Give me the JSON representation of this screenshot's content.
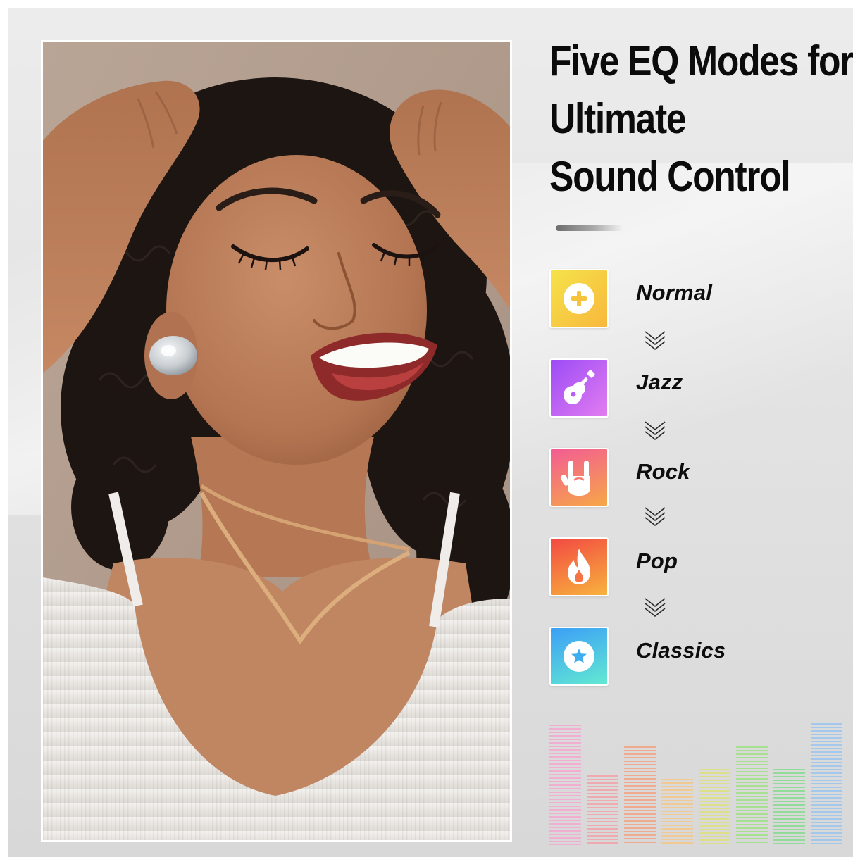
{
  "headline": {
    "line1": "Five EQ Modes for",
    "line2": "Ultimate",
    "line3": "Sound Control"
  },
  "modes": [
    {
      "label": "Normal",
      "icon": "plus-circle-icon",
      "gradient": [
        "#f4d73b",
        "#f9b43c"
      ]
    },
    {
      "label": "Jazz",
      "icon": "guitar-icon",
      "gradient": [
        "#b04ff5",
        "#d46ef3"
      ]
    },
    {
      "label": "Rock",
      "icon": "rock-hand-icon",
      "gradient": [
        "#f46b8c",
        "#f7a24b"
      ]
    },
    {
      "label": "Pop",
      "icon": "flame-icon",
      "gradient": [
        "#f4503f",
        "#f8a43d"
      ]
    },
    {
      "label": "Classics",
      "icon": "star-circle-icon",
      "gradient": [
        "#3ea6f6",
        "#5ee6d8"
      ]
    }
  ],
  "equalizer": {
    "levels": [
      0.95,
      0.55,
      0.78,
      0.52,
      0.6,
      0.78,
      0.6,
      0.96
    ],
    "colors": [
      "#f5a6cf",
      "#f3a1a8",
      "#f3a283",
      "#f5c685",
      "#dfe07b",
      "#9fe184",
      "#86dc8f",
      "#9bc4f0"
    ]
  }
}
